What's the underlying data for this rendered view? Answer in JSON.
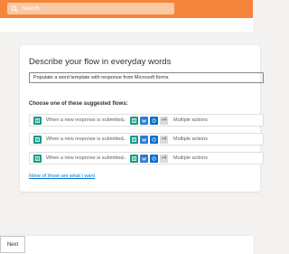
{
  "colors": {
    "accent": "#f4853a",
    "link": "#0078d4",
    "forms": "#1a9a87",
    "word": "#2b7cd3",
    "outlook": "#0a6fcc"
  },
  "header": {
    "search_placeholder": "Search",
    "search_icon": "search-icon"
  },
  "card": {
    "title": "Describe your flow in everyday words",
    "prompt_value": "Populate a word template with response from Microsoft forms",
    "suggestions_label": "Choose one of these suggested flows:",
    "flows": [
      {
        "trigger": "When a new response is submitted",
        "plus_badge": "+4",
        "actions": "Multiple actions"
      },
      {
        "trigger": "When a new response is submitted",
        "plus_badge": "+4",
        "actions": "Multiple actions"
      },
      {
        "trigger": "When a new response is submitted",
        "plus_badge": "+4",
        "actions": "Multiple actions"
      }
    ],
    "none_link": "None of those are what I want"
  },
  "footer": {
    "next_label": "Next"
  }
}
